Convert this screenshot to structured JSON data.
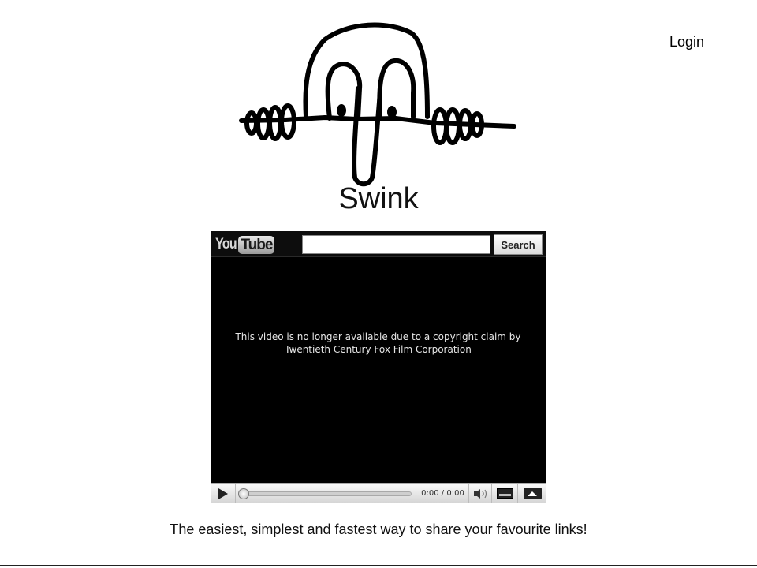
{
  "header": {
    "login_label": "Login"
  },
  "brand": {
    "title": "Swink"
  },
  "player": {
    "search_placeholder": "",
    "search_button_label": "Search",
    "message": "This video is no longer available due to a copyright claim by Twentieth Century Fox Film Corporation",
    "time": "0:00 / 0:00",
    "progress_fraction": 0,
    "icons": {
      "logo": "youtube-logo",
      "play": "play-icon",
      "volume": "volume-icon",
      "size": "player-size-icon",
      "fullscreen": "fullscreen-icon"
    }
  },
  "footer": {
    "tagline": "The easiest, simplest and fastest way to share your favourite links!"
  }
}
